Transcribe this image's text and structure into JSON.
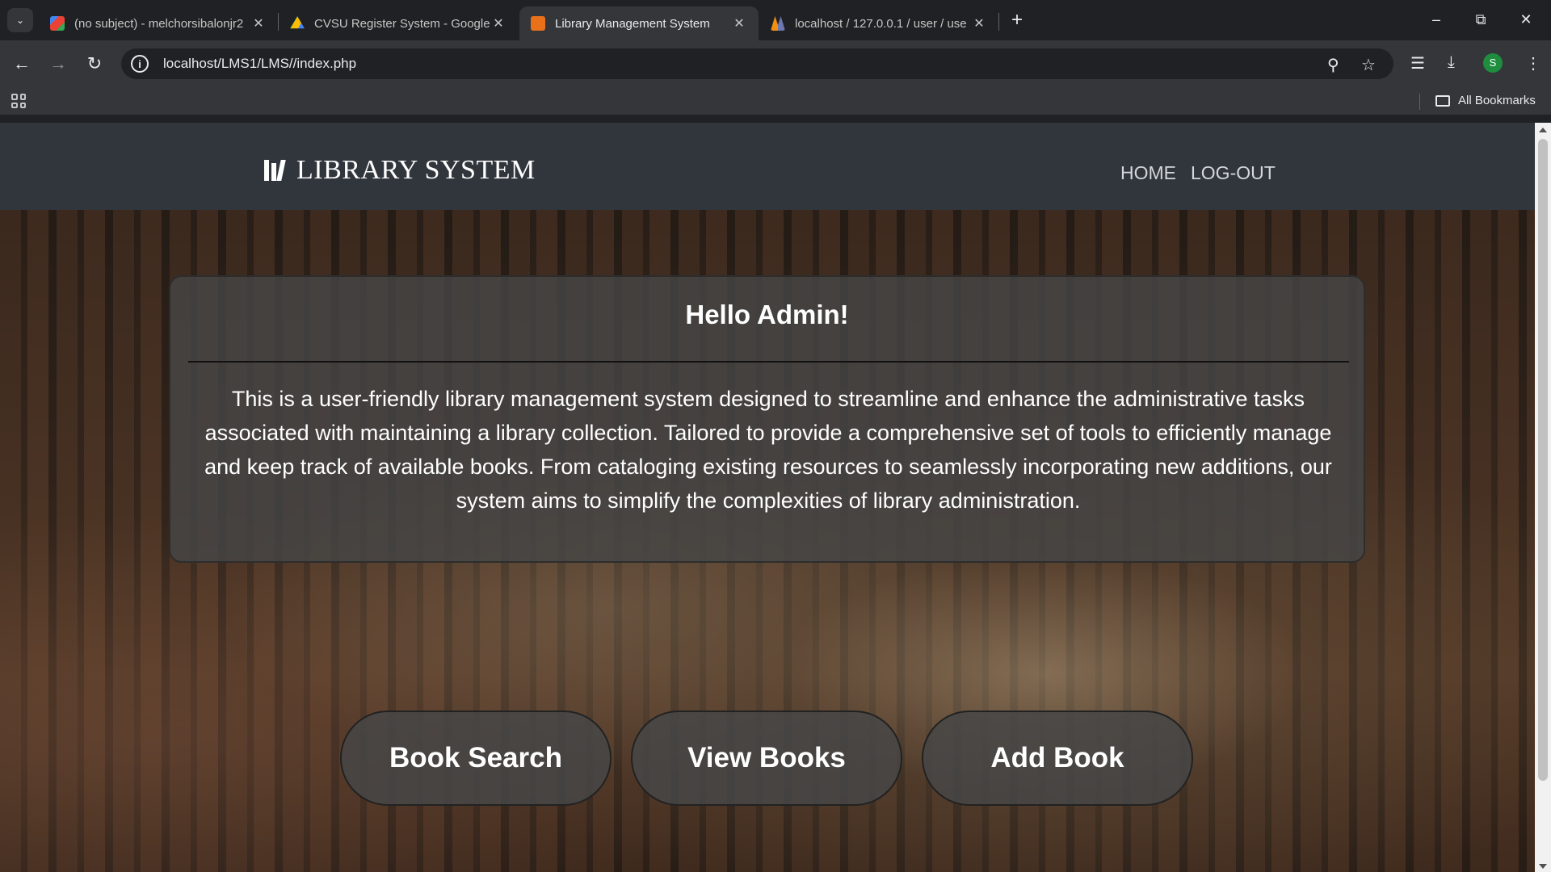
{
  "browser": {
    "tabs": [
      {
        "title": "(no subject) - melchorsibalonjr2",
        "favicon_color": "#ea4335"
      },
      {
        "title": "CVSU Register System - Google",
        "favicon_color": "#fbbc04"
      },
      {
        "title": "Library Management System",
        "favicon_color": "#e8711a"
      },
      {
        "title": "localhost / 127.0.0.1 / user / use",
        "favicon_color": "#f29111"
      }
    ],
    "active_tab_index": 2,
    "url": "localhost/LMS1/LMS//index.php",
    "profile_initial": "S",
    "all_bookmarks_label": "All Bookmarks"
  },
  "site": {
    "brand": "LIBRARY SYSTEM",
    "nav": {
      "home": "HOME",
      "logout": "LOG-OUT"
    },
    "card": {
      "heading": "Hello Admin!",
      "body": "This is a user-friendly library management system designed to streamline and enhance the administrative tasks associated with maintaining a library collection. Tailored to provide a comprehensive set of tools to efficiently manage and keep track of available books. From cataloging existing resources to seamlessly incorporating new additions, our system aims to simplify the complexities of library administration."
    },
    "buttons": {
      "search": "Book Search",
      "view": "View Books",
      "add": "Add Book"
    }
  },
  "colors": {
    "header_bg": "#31363d",
    "card_bg": "#464646",
    "text": "#ffffff"
  }
}
